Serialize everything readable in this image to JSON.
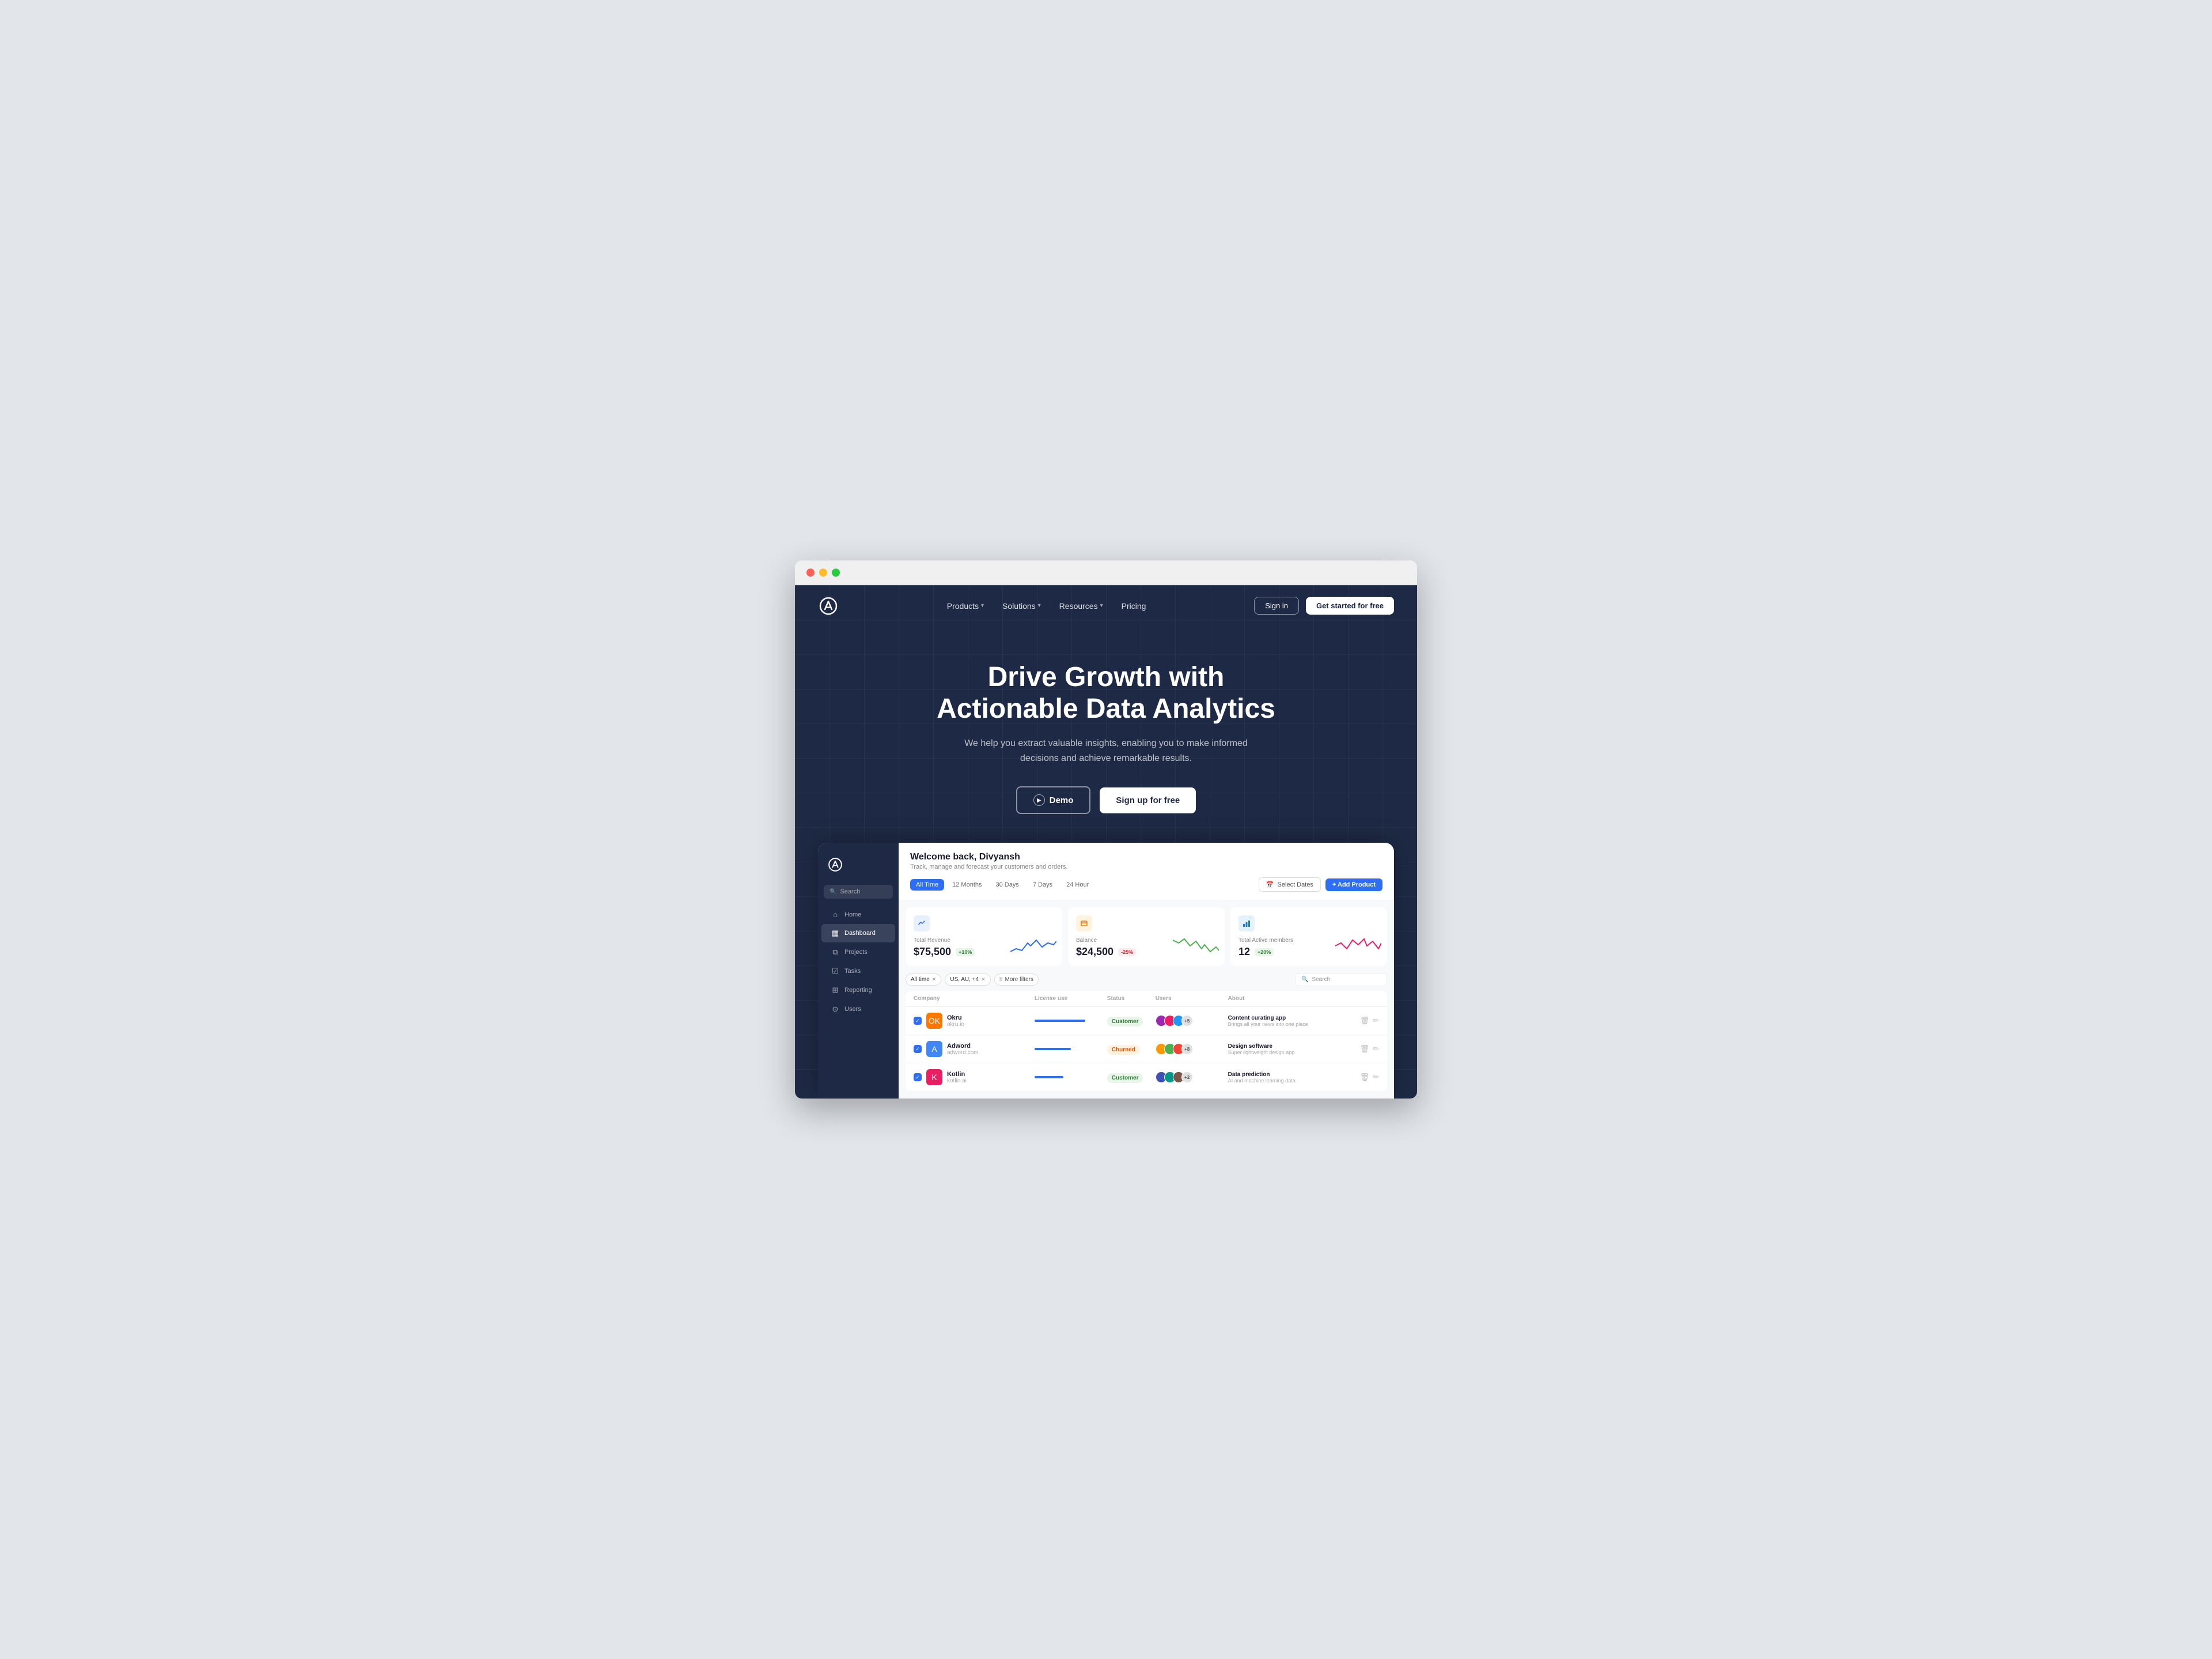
{
  "browser": {
    "traffic_lights": [
      "red",
      "yellow",
      "green"
    ]
  },
  "navbar": {
    "logo_text": "A",
    "links": [
      {
        "label": "Products",
        "has_dropdown": true
      },
      {
        "label": "Solutions",
        "has_dropdown": true
      },
      {
        "label": "Resources",
        "has_dropdown": true
      },
      {
        "label": "Pricing",
        "has_dropdown": false
      }
    ],
    "signin_label": "Sign in",
    "get_started_label": "Get started for free"
  },
  "hero": {
    "title_line1": "Drive Growth with",
    "title_line2": "Actionable Data Analytics",
    "subtitle": "We help you extract valuable insights, enabling you to make informed decisions and achieve remarkable results.",
    "btn_demo": "Demo",
    "btn_signup": "Sign up for free"
  },
  "dashboard": {
    "welcome_title": "Welcome back, Divyansh",
    "welcome_sub": "Track, manage and forecast your customers and orders.",
    "time_tabs": [
      {
        "label": "All Time",
        "active": true
      },
      {
        "label": "12 Months",
        "active": false
      },
      {
        "label": "30 Days",
        "active": false
      },
      {
        "label": "7 Days",
        "active": false
      },
      {
        "label": "24 Hour",
        "active": false
      }
    ],
    "select_dates_label": "Select Dates",
    "add_product_label": "+ Add Product",
    "metrics": [
      {
        "icon": "✓",
        "icon_style": "blue",
        "label": "Total Revenue",
        "value": "$75,500",
        "badge": "+10%",
        "badge_type": "green"
      },
      {
        "icon": "▣",
        "icon_style": "orange",
        "label": "Balance",
        "value": "$24,500",
        "badge": "-25%",
        "badge_type": "red"
      },
      {
        "icon": "▦",
        "icon_style": "lightblue",
        "label": "Total Active members",
        "value": "12",
        "badge": "+20%",
        "badge_type": "green"
      }
    ],
    "table": {
      "filter_chips": [
        {
          "label": "All time",
          "removable": true
        },
        {
          "label": "US, AU, +4",
          "removable": true
        },
        {
          "label": "More filters",
          "removable": false,
          "icon": true
        }
      ],
      "search_placeholder": "Search",
      "columns": [
        "Company",
        "License use",
        "Status",
        "Users",
        "About",
        ""
      ],
      "rows": [
        {
          "id": 1,
          "company_name": "Okru",
          "company_url": "okru.io",
          "logo_text": "OK",
          "logo_style": "okru",
          "status": "Customer",
          "status_type": "customer",
          "about_title": "Content curating app",
          "about_desc": "Brings all your news into one place",
          "user_count": "+5"
        },
        {
          "id": 2,
          "company_name": "Adword",
          "company_url": "adword.com",
          "logo_text": "A",
          "logo_style": "adword",
          "status": "Churned",
          "status_type": "churned",
          "about_title": "Design software",
          "about_desc": "Super lightweight design app",
          "user_count": "+8"
        },
        {
          "id": 3,
          "company_name": "Kotlin",
          "company_url": "kotlin.ai",
          "logo_text": "K",
          "logo_style": "kotlin",
          "status": "Customer",
          "status_type": "customer",
          "about_title": "Data prediction",
          "about_desc": "AI and machine learning data",
          "user_count": "+2"
        }
      ]
    },
    "sidebar": {
      "nav_items": [
        {
          "label": "Home",
          "icon": "⌂",
          "active": false
        },
        {
          "label": "Dashboard",
          "icon": "▦",
          "active": true
        },
        {
          "label": "Projects",
          "icon": "⧉",
          "active": false
        },
        {
          "label": "Tasks",
          "icon": "☑",
          "active": false
        },
        {
          "label": "Reporting",
          "icon": "⊞",
          "active": false
        },
        {
          "label": "Users",
          "icon": "⊙",
          "active": false
        }
      ],
      "search_placeholder": "Search"
    }
  }
}
